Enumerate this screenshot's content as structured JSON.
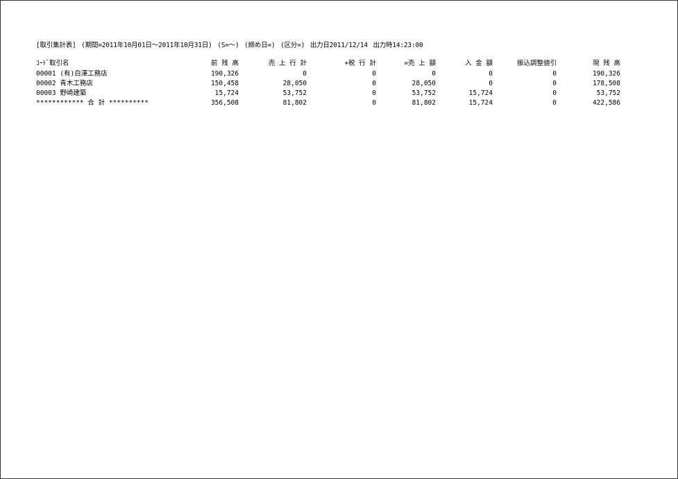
{
  "report": {
    "title": "[取引集計表]",
    "period": "(期間=2011年10月01日～2011年10月31日)",
    "s_filter": "(S=～)",
    "closing_day": "(締め日=)",
    "category": "(区分=)",
    "output_date": "出力日2011/12/14",
    "output_time": "出力時14:23:00"
  },
  "table": {
    "headers": {
      "name": "ｺｰﾄﾞ取引名",
      "prev_balance": "前 残 高",
      "sales_total": "売 上 行 計",
      "tax_total": "+税 行 計",
      "sales_amount": "=売 上 額",
      "receipt_amount": "入 金 額",
      "adjustment": "振込調整値引",
      "current_balance": "現 残 高"
    },
    "rows": [
      {
        "name": "00001 (有)白澤工務店",
        "prev_balance": "190,326",
        "sales_total": "0",
        "tax_total": "0",
        "sales_amount": "0",
        "receipt_amount": "0",
        "adjustment": "0",
        "current_balance": "190,326"
      },
      {
        "name": "00002 青木工務店",
        "prev_balance": "150,458",
        "sales_total": "28,050",
        "tax_total": "0",
        "sales_amount": "28,050",
        "receipt_amount": "0",
        "adjustment": "0",
        "current_balance": "178,508"
      },
      {
        "name": "00003 野崎建築",
        "prev_balance": "15,724",
        "sales_total": "53,752",
        "tax_total": "0",
        "sales_amount": "53,752",
        "receipt_amount": "15,724",
        "adjustment": "0",
        "current_balance": "53,752"
      }
    ],
    "total": {
      "name": "************ 合 計 **********",
      "prev_balance": "356,508",
      "sales_total": "81,802",
      "tax_total": "0",
      "sales_amount": "81,802",
      "receipt_amount": "15,724",
      "adjustment": "0",
      "current_balance": "422,586"
    }
  }
}
